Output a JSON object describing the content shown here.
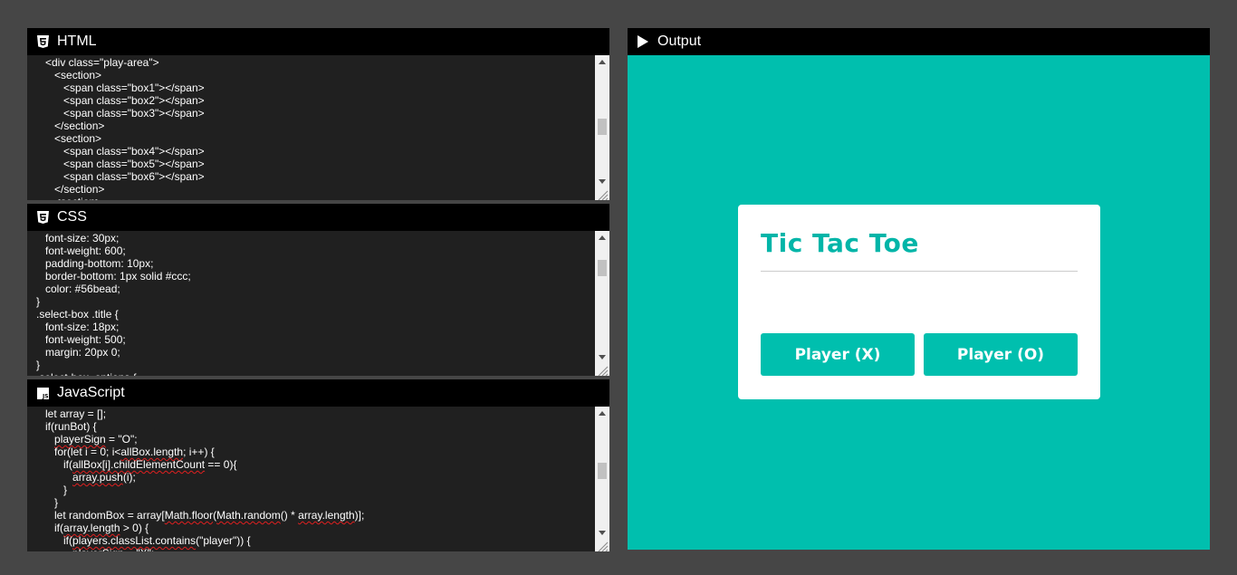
{
  "panels": {
    "html": {
      "title": "HTML",
      "lines": [
        "      <div class=\"play-area\">",
        "         <section>",
        "            <span class=\"box1\"></span>",
        "            <span class=\"box2\"></span>",
        "            <span class=\"box3\"></span>",
        "         </section>",
        "         <section>",
        "            <span class=\"box4\"></span>",
        "            <span class=\"box5\"></span>",
        "            <span class=\"box6\"></span>",
        "         </section>",
        "         <section>"
      ]
    },
    "css": {
      "title": "CSS",
      "lines": [
        "      font-size: 30px;",
        "      font-weight: 600;",
        "      padding-bottom: 10px;",
        "      border-bottom: 1px solid #ccc;",
        "      color: #56bead;",
        "   }",
        "   .select-box .title {",
        "      font-size: 18px;",
        "      font-weight: 500;",
        "      margin: 20px 0;",
        "   }",
        "   .select-box .options {"
      ]
    },
    "js": {
      "title": "JavaScript",
      "lines": [
        "      let array = [];",
        "      if(runBot) {",
        "         playerSign = \"O\";",
        "         for(let i = 0; i<allBox.length; i++) {",
        "            if(allBox[i].childElementCount == 0){",
        "               array.push(i);",
        "            }",
        "         }",
        "         let randomBox = array[Math.floor(Math.random() * array.length)];",
        "         if(array.length > 0) {",
        "            if(players.classList.contains(\"player\")) {",
        "               playerSign = \"X\";"
      ]
    },
    "output": {
      "title": "Output"
    }
  },
  "select_box": {
    "title": "Tic Tac Toe",
    "player_x_label": "Player (X)",
    "player_o_label": "Player (O)"
  },
  "colors": {
    "accent": "#00bfae",
    "title_color": "#00b5a8",
    "editor_bg": "#202020",
    "header_bg": "#000000",
    "page_bg": "#464646"
  },
  "icons": {
    "html": "html5-icon",
    "css": "css3-icon",
    "js": "js-icon",
    "output": "play-icon"
  }
}
